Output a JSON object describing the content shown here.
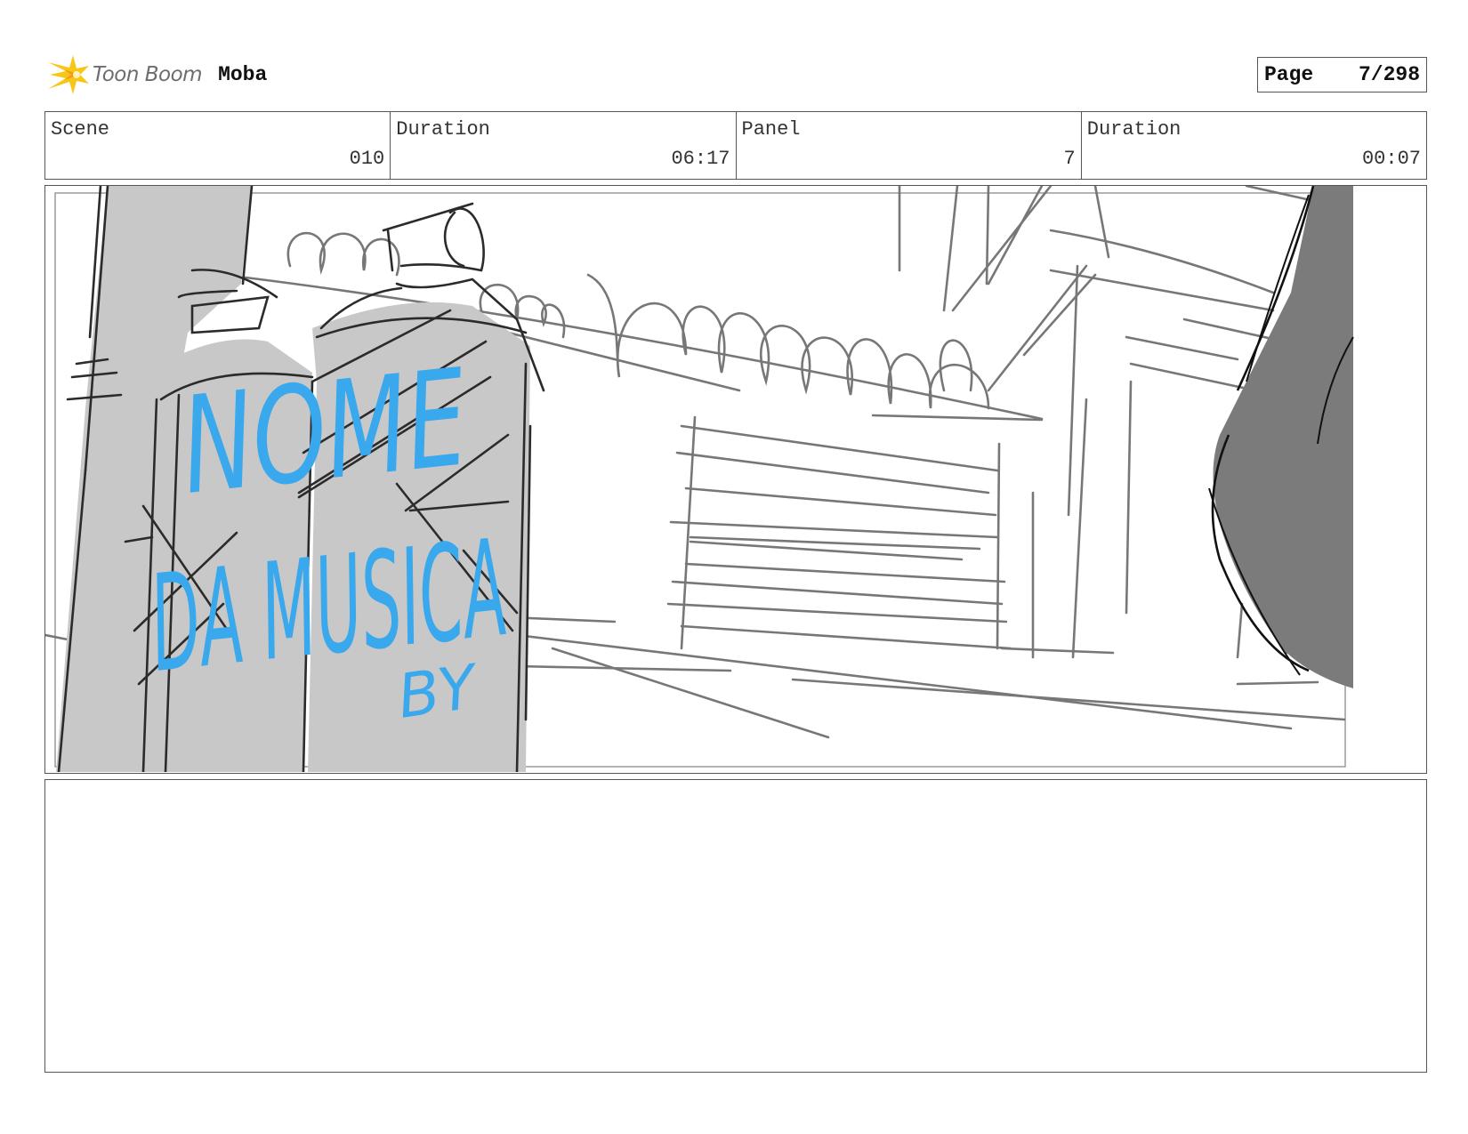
{
  "header": {
    "logo_text": "Toon Boom",
    "project_name": "Moba",
    "page_label": "Page",
    "page_value": "7/298"
  },
  "info": {
    "scene_label": "Scene",
    "scene_value": "010",
    "scene_duration_label": "Duration",
    "scene_duration_value": "06:17",
    "panel_label": "Panel",
    "panel_value": "7",
    "panel_duration_label": "Duration",
    "panel_duration_value": "00:07"
  },
  "panel": {
    "sign_line_1": "NOME",
    "sign_line_2": "DA MUSICA",
    "sign_line_3": "BY"
  },
  "icons": {
    "logo": "toon-boom-logo-icon"
  },
  "colors": {
    "blue_ink": "#3aa8ec",
    "logo_yellow": "#f7c617",
    "sketch_gray": "#777777",
    "fill_gray": "#c8c8c8",
    "dark_gray": "#7b7b7b"
  },
  "notes": {
    "text": ""
  }
}
